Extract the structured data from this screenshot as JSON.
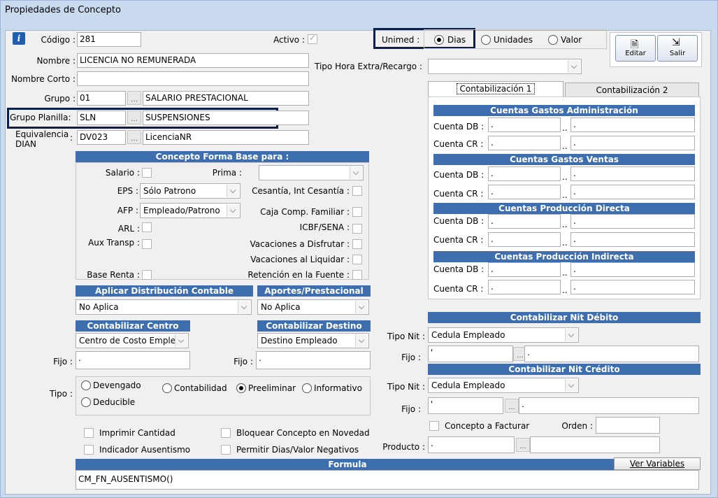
{
  "window": {
    "title": "Propiedades de Concepto"
  },
  "info_icon_glyph": "i",
  "codigo": {
    "label": "Código :",
    "value": "281"
  },
  "activo": {
    "label": "Activo :",
    "checked": true
  },
  "nombre": {
    "label": "Nombre :",
    "value": "LICENCIA NO REMUNERADA"
  },
  "nombre_corto": {
    "label": "Nombre Corto :",
    "value": ""
  },
  "grupo": {
    "label": "Grupo :",
    "code": "01",
    "desc": "SALARIO PRESTACIONAL"
  },
  "grupo_planilla": {
    "label": "Grupo Planilla:",
    "code": "SLN",
    "desc": "SUSPENSIONES"
  },
  "equivalencia": {
    "label1": "Equivalencia",
    "label2": "DIAN",
    "colon": ":",
    "code": "DV023",
    "desc": "LicenciaNR"
  },
  "dots": "...",
  "unimed": {
    "label": "Unimed :",
    "options": [
      "Dias",
      "Unidades",
      "Valor"
    ],
    "selected": "Dias"
  },
  "buttons": {
    "editar": "Editar",
    "salir": "Salir"
  },
  "tipo_hora": {
    "label": "Tipo Hora Extra/Recargo :",
    "value": ""
  },
  "tabs": [
    "Contabilización 1",
    "Contabilización 2"
  ],
  "cuentas": {
    "admin_title": "Cuentas Gastos Administración",
    "ventas_title": "Cuentas Gastos Ventas",
    "prod_dir_title": "Cuentas Producción Directa",
    "prod_ind_title": "Cuentas Producción Indirecta",
    "db_label": "Cuenta DB :",
    "cr_label": "Cuenta CR :",
    "value": ".",
    "sep": ".."
  },
  "forma_base": {
    "title": "Concepto Forma Base para :",
    "salario": "Salario :",
    "prima": "Prima :",
    "eps": "EPS :",
    "eps_value": "Sólo Patrono",
    "cesantia": "Cesantía, Int Cesantía :",
    "afp": "AFP :",
    "afp_value": "Empleado/Patrono",
    "caja": "Caja Comp. Familiar :",
    "arl": "ARL :",
    "icbf": "ICBF/SENA :",
    "aux": "Aux Transp :",
    "vac_disf": "Vacaciones a Disfrutar :",
    "vac_liq": "Vacaciones al Liquidar :",
    "base_renta": "Base Renta :",
    "retencion": "Retención en la Fuente :"
  },
  "aplicar_dist": {
    "title": "Aplicar Distribución Contable",
    "value": "No Aplica"
  },
  "aportes": {
    "title": "Aportes/Prestacional",
    "value": "No Aplica"
  },
  "cont_centro": {
    "title": "Contabilizar Centro",
    "value": "Centro de Costo Emple",
    "fijo_label": "Fijo :",
    "fijo_value": "."
  },
  "cont_destino": {
    "title": "Contabilizar Destino",
    "value": "Destino Empleado",
    "fijo_label": "Fijo :",
    "fijo_value": "."
  },
  "tipo": {
    "label": "Tipo :",
    "options": [
      "Devengado",
      "Deducible",
      "Contabilidad",
      "Preeliminar",
      "Informativo"
    ],
    "selected": "Preeliminar"
  },
  "nit_debito": {
    "title": "Contabilizar Nit Débito",
    "tipo_label": "Tipo Nit :",
    "tipo_value": "Cedula Empleado",
    "fijo_label": "Fijo :",
    "fijo_value": "'",
    "fijo_value2": "."
  },
  "nit_credito": {
    "title": "Contabilizar Nit Crédito",
    "tipo_label": "Tipo Nit :",
    "tipo_value": "Cedula Empleado",
    "fijo_label": "Fijo :",
    "fijo_value": "'",
    "fijo_value2": "."
  },
  "checks": {
    "imprimir": "Imprimir Cantidad",
    "bloquear": "Bloquear Concepto en Novedad",
    "ausentismo": "Indicador Ausentismo",
    "permitir": "Permitir Dias/Valor Negativos",
    "facturar": "Concepto a Facturar"
  },
  "orden": {
    "label": "Orden :",
    "value": ""
  },
  "producto": {
    "label": "Producto :",
    "value": "."
  },
  "formula": {
    "title": "Formula",
    "ver_variables": "Ver Variables",
    "value": "CM_FN_AUSENTISMO()"
  }
}
